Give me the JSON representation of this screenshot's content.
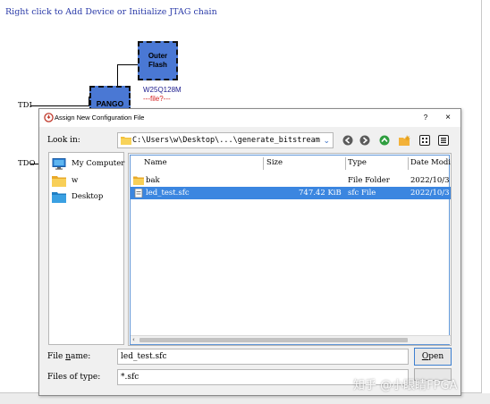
{
  "canvas": {
    "hint": "Right click to Add Device or Initialize JTAG chain",
    "tdi_label": "TDI",
    "tdo_label": "TDO",
    "flash_line1": "Outer",
    "flash_line2": "Flash",
    "flash_part": "W25Q128M",
    "flash_file": "---file?---",
    "device_label": "PANGO"
  },
  "dialog": {
    "title": "Assign New Configuration File",
    "help": "?",
    "close": "×",
    "look_in_label": "Look in:",
    "look_in_path": "C:\\Users\\w\\Desktop\\...\\generate_bitstream",
    "toolbar": [
      "back-icon",
      "forward-icon",
      "parent-folder-icon",
      "new-folder-icon",
      "list-view-icon",
      "detail-view-icon"
    ],
    "places": [
      {
        "label": "My Computer",
        "icon": "computer-icon"
      },
      {
        "label": "w",
        "icon": "folder-icon"
      },
      {
        "label": "Desktop",
        "icon": "desktop-icon"
      }
    ],
    "columns": {
      "name": "Name",
      "size": "Size",
      "type": "Type",
      "date": "Date Modi"
    },
    "files": [
      {
        "name": "bak",
        "size": "",
        "type": "File Folder",
        "date": "2022/10/3",
        "icon": "folder-icon",
        "selected": false
      },
      {
        "name": "led_test.sfc",
        "size": "747.42 KiB",
        "type": "sfc File",
        "date": "2022/10/3",
        "icon": "file-icon",
        "selected": true
      }
    ],
    "file_name_label_pre": "File ",
    "file_name_label_u": "n",
    "file_name_label_post": "ame:",
    "file_name_value": "led_test.sfc",
    "files_of_type_label": "Files of type:",
    "files_of_type_value": "*.sfc",
    "open_label_u": "O",
    "open_label_post": "pen"
  },
  "colors": {
    "accent": "#3b86e0",
    "chip": "#4a78d4",
    "hint_text": "#2a3aa8",
    "error_text": "#d42020"
  },
  "watermark": "知乎 @小眼睛FPGA"
}
